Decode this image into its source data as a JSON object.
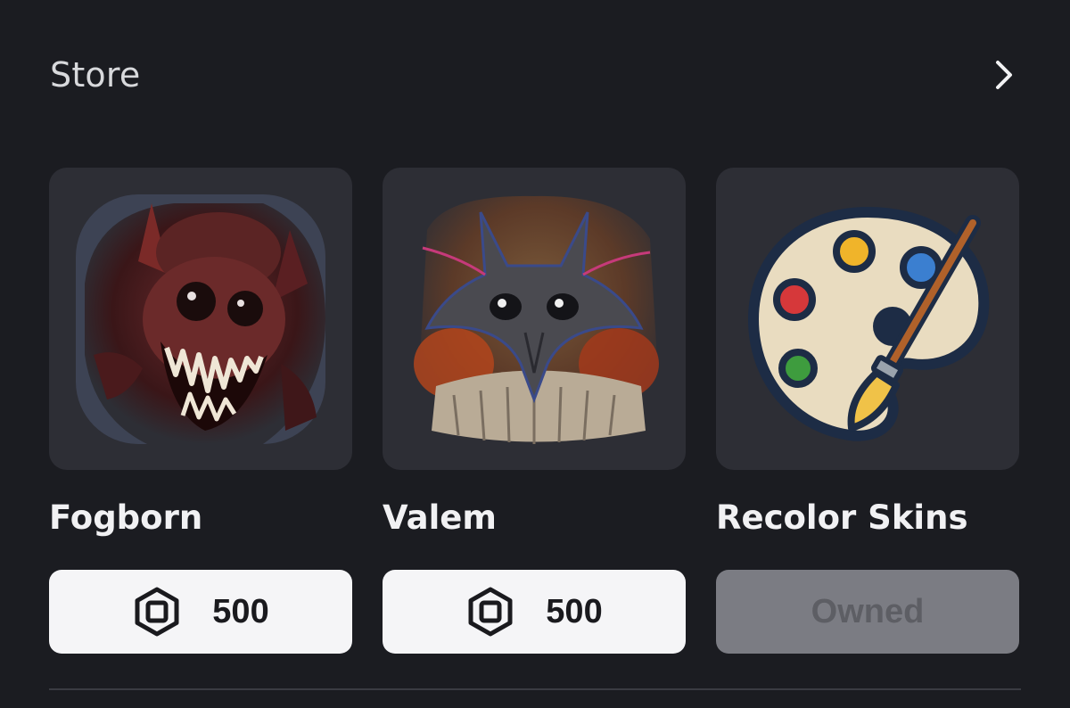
{
  "store": {
    "title": "Store",
    "see_all_icon": "chevron-right-icon"
  },
  "items": [
    {
      "name": "Fogborn",
      "image_icon": "fogborn-monster-thumbnail",
      "currency_icon": "robux-icon",
      "price": "500"
    },
    {
      "name": "Valem",
      "image_icon": "valem-creature-thumbnail",
      "currency_icon": "robux-icon",
      "price": "500"
    },
    {
      "name": "Recolor Skins",
      "image_icon": "paint-palette-icon",
      "status": "Owned"
    }
  ],
  "colors": {
    "background": "#1b1c21",
    "card": "#2d2e35",
    "buy_button": "#f5f5f7",
    "owned_button": "#7b7c83"
  }
}
